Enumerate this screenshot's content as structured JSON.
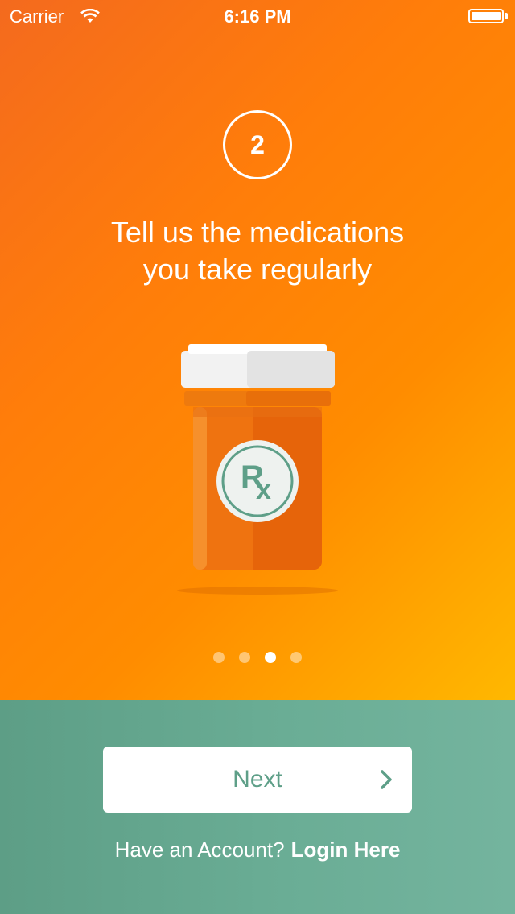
{
  "status_bar": {
    "carrier": "Carrier",
    "time": "6:16 PM"
  },
  "onboarding": {
    "step_number": "2",
    "headline_line1": "Tell us the medications",
    "headline_line2": "you take regularly",
    "illustration_icon": "prescription-bottle-icon",
    "rx_symbol_r": "R",
    "rx_symbol_x": "x",
    "page_count": 4,
    "active_page": 3
  },
  "actions": {
    "next_label": "Next",
    "account_prompt": "Have an Account?",
    "login_label": "Login Here"
  },
  "colors": {
    "gradient_start": "#f46a1e",
    "gradient_end": "#ffb800",
    "accent_green": "#5e9f88",
    "white": "#ffffff"
  }
}
